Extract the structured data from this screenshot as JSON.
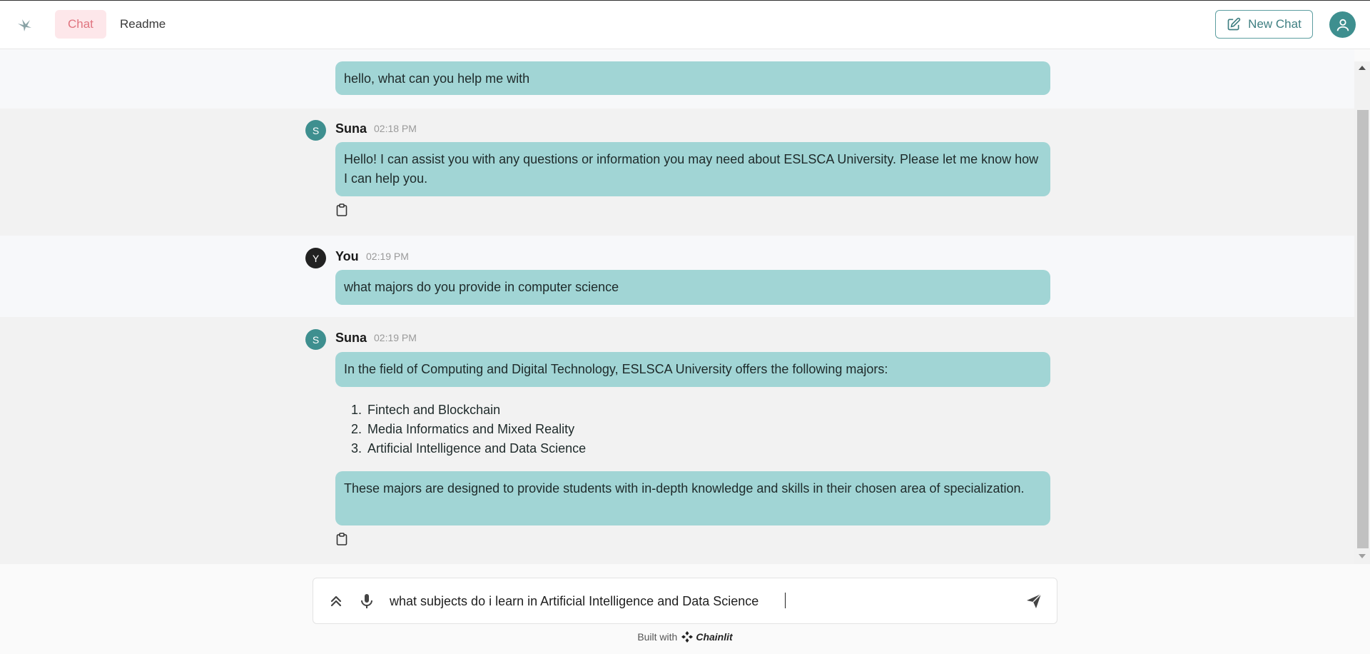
{
  "header": {
    "tabs": [
      {
        "label": "Chat",
        "active": true
      },
      {
        "label": "Readme",
        "active": false
      }
    ],
    "new_chat_label": "New Chat"
  },
  "messages": [
    {
      "role": "user",
      "text": "hello, what can you help me with"
    },
    {
      "role": "bot",
      "author": "Suna",
      "avatar": "S",
      "time": "02:18 PM",
      "text": "Hello! I can assist you with any questions or information you may need about ESLSCA University. Please let me know how I can help you."
    },
    {
      "role": "user",
      "author": "You",
      "avatar": "Y",
      "time": "02:19 PM",
      "text": "what majors do you provide in computer science"
    },
    {
      "role": "bot",
      "author": "Suna",
      "avatar": "S",
      "time": "02:19 PM",
      "text": "In the field of Computing and Digital Technology, ESLSCA University offers the following majors:",
      "list": [
        {
          "num": "1.",
          "text": "Fintech and Blockchain"
        },
        {
          "num": "2.",
          "text": "Media Informatics and Mixed Reality"
        },
        {
          "num": "3.",
          "text": "Artificial Intelligence and Data Science"
        }
      ],
      "followup": "These majors are designed to provide students with in-depth knowledge and skills in their chosen area of specialization."
    }
  ],
  "composer": {
    "value": "what subjects do i learn in Artificial Intelligence and Data Science"
  },
  "footer": {
    "built_with": "Built with",
    "brand": "Chainlit"
  },
  "icons": {
    "logo": "bird-logo-icon",
    "new_chat": "edit-icon",
    "avatar": "user-icon",
    "copy": "clipboard-icon",
    "expand": "double-chevron-up-icon",
    "mic": "microphone-icon",
    "send": "send-icon"
  },
  "colors": {
    "accent": "#3e8f8f",
    "bubble": "#a1d5d5",
    "active_tab_bg": "#fde7ea",
    "active_tab_text": "#e0747f"
  }
}
